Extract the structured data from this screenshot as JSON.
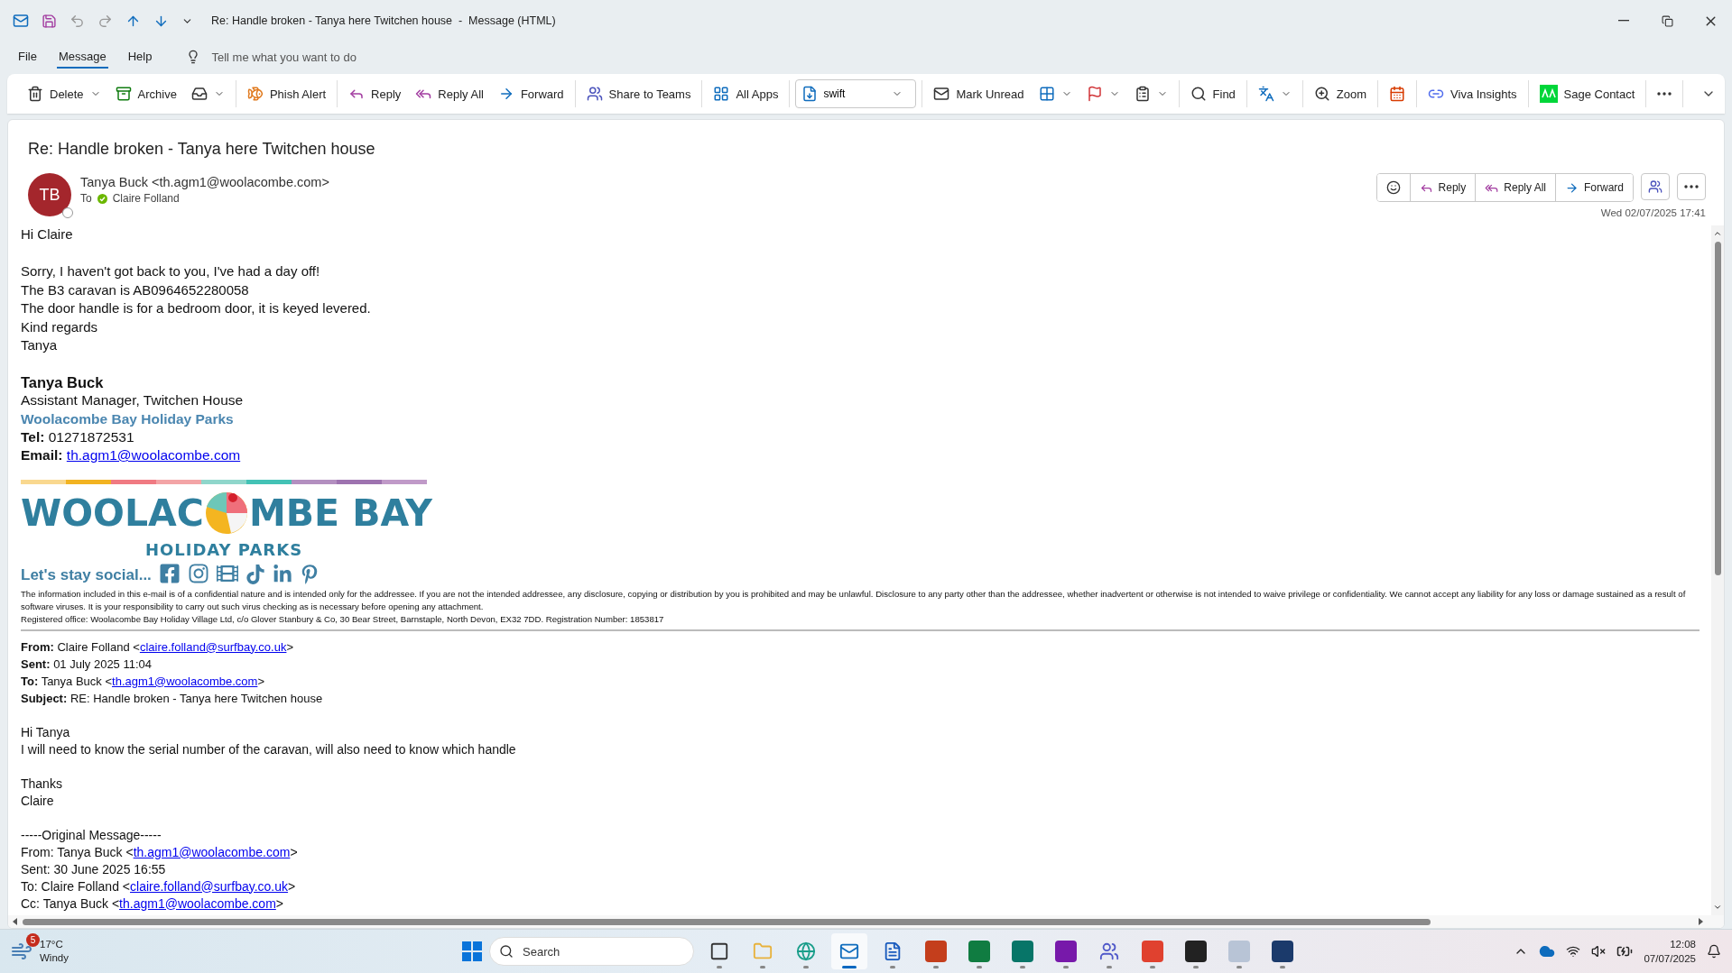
{
  "title_bar": {
    "title": "Re: Handle broken - Tanya here Twitchen house  -  Message (HTML)"
  },
  "menu_tabs": [
    {
      "label": "File",
      "selected": false
    },
    {
      "label": "Message",
      "selected": true
    },
    {
      "label": "Help",
      "selected": false
    }
  ],
  "tell_me": {
    "placeholder": "Tell me what you want to do"
  },
  "ribbon_groups": [
    {
      "items": [
        {
          "label": "Delete",
          "dropdown": true
        },
        {
          "label": "Archive",
          "dropdown": false
        },
        {
          "dropdown": true
        }
      ]
    },
    {
      "items": [
        {
          "label": "Phish Alert",
          "dropdown": false
        }
      ]
    },
    {
      "items": [
        {
          "label": "Reply",
          "dropdown": false
        },
        {
          "label": "Reply All",
          "dropdown": false
        },
        {
          "label": "Forward",
          "dropdown": false
        }
      ]
    },
    {
      "items": [
        {
          "label": "Share to Teams",
          "dropdown": false
        }
      ]
    },
    {
      "items": [
        {
          "label": "All Apps",
          "dropdown": false
        }
      ]
    },
    {
      "items": [
        {
          "kind": "combo",
          "value": "swift",
          "dropdown": true
        }
      ]
    },
    {
      "items": [
        {
          "label": "Mark Unread",
          "dropdown": false
        },
        {
          "dropdown": true
        },
        {
          "dropdown": true
        },
        {
          "dropdown": true
        }
      ]
    },
    {
      "items": [
        {
          "label": "Find",
          "dropdown": false
        }
      ]
    },
    {
      "items": [
        {
          "dropdown": true
        }
      ]
    },
    {
      "items": [
        {
          "label": "Zoom",
          "dropdown": false
        }
      ]
    },
    {
      "items": [
        {
          "dropdown": false
        }
      ]
    },
    {
      "items": [
        {
          "label": "Viva Insights",
          "dropdown": false
        }
      ]
    },
    {
      "items": [
        {
          "label": "Sage Contact",
          "dropdown": false
        }
      ]
    },
    {
      "items": [
        {
          "dropdown": false
        }
      ]
    }
  ],
  "message": {
    "subject": "Re: Handle broken - Tanya here Twitchen house",
    "avatar": "TB",
    "sender": "Tanya Buck <th.agm1@woolacombe.com>",
    "to_label": "To",
    "recipient": "Claire Folland",
    "date": "Wed 02/07/2025 17:41",
    "actions": [
      {
        "label": "Reply"
      },
      {
        "label": "Reply All"
      },
      {
        "label": "Forward"
      }
    ]
  },
  "body": {
    "paragraphs": [
      [
        "Hi Claire"
      ],
      [
        "Sorry, I haven't got back to you, I've had a day off!",
        "The B3 caravan is AB0964652280058",
        "The door handle is for a bedroom door, it is keyed levered.",
        "Kind regards",
        "Tanya"
      ]
    ],
    "signature": {
      "name": "Tanya Buck",
      "role": "Assistant Manager, Twitchen House",
      "company": "Woolacombe Bay Holiday Parks",
      "tel_label": "Tel:",
      "tel": "01271872531",
      "email_label": "Email:",
      "email": "th.agm1@woolacombe.com"
    },
    "logo": {
      "left": "WOOLAC",
      "right": "MBE BAY",
      "subtitle": "HOLIDAY PARKS"
    },
    "social": "Let's stay social...",
    "disclaimer": "The information included in this e-mail is of a confidential nature and is intended only for the addressee. If you are not the intended addressee, any disclosure, copying or distribution by you is prohibited and may be unlawful. Disclosure to any party other than the addressee, whether inadvertent or otherwise is not intended to waive privilege or confidentiality. We cannot accept any liability for any loss or damage sustained as a result of software viruses. It is your responsibility to carry out such virus checking as is necessary before opening any attachment.",
    "registered": "Registered office: Woolacombe Bay Holiday Village Ltd, c/o Glover Stanbury & Co, 30 Bear Street, Barnstaple, North Devon, EX32 7DD. Registration Number: 1853817",
    "quoted_header": [
      {
        "label": "From:",
        "text": "Claire Folland <",
        "link": "claire.folland@surfbay.co.uk",
        "after": ">"
      },
      {
        "label": "Sent:",
        "text": "01 July 2025 11:04"
      },
      {
        "label": "To:",
        "text": "Tanya Buck <",
        "link": "th.agm1@woolacombe.com",
        "after": ">"
      },
      {
        "label": "Subject:",
        "text": "RE: Handle broken - Tanya here Twitchen house"
      }
    ],
    "quoted_paragraphs": [
      [
        {
          "text": "Hi Tanya"
        },
        {
          "text": "I will need to know the serial number of the caravan, will also need to know which handle"
        }
      ],
      [
        {
          "text": "Thanks"
        },
        {
          "text": "Claire"
        }
      ],
      [
        {
          "text": "-----Original Message-----"
        },
        {
          "text": "From: Tanya Buck <",
          "link": "th.agm1@woolacombe.com",
          "after": ">"
        },
        {
          "text": "Sent: 30 June 2025 16:55"
        },
        {
          "text": "To: Claire Folland <",
          "link": "claire.folland@surfbay.co.uk",
          "after": ">"
        },
        {
          "text": "Cc: Tanya Buck <",
          "link": "th.agm1@woolacombe.com",
          "after": ">"
        }
      ]
    ]
  },
  "taskbar": {
    "weather": {
      "badge": "5",
      "temp": "17°C",
      "condition": "Windy"
    },
    "search": {
      "placeholder": "Search"
    },
    "apps": [
      {
        "selected": false
      },
      {
        "selected": false
      },
      {
        "selected": false
      },
      {
        "selected": true
      },
      {
        "selected": false
      },
      {
        "selected": false
      },
      {
        "selected": false
      },
      {
        "selected": false
      },
      {
        "selected": false
      },
      {
        "selected": false
      },
      {
        "selected": false
      },
      {
        "selected": false
      },
      {
        "selected": false
      },
      {
        "selected": false
      }
    ],
    "time": "12:08",
    "date": "07/07/2025"
  }
}
